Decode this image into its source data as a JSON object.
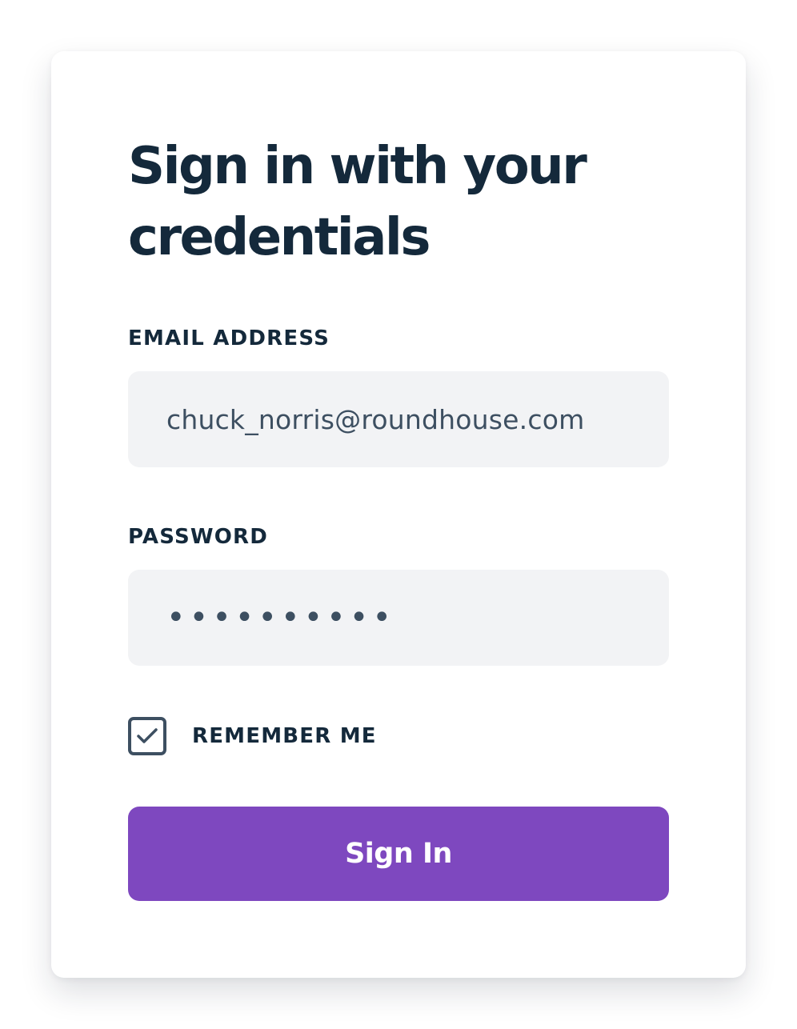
{
  "form": {
    "heading": "Sign in with your credentials",
    "email_label": "EMAIL ADDRESS",
    "email_value": "chuck_norris@roundhouse.com",
    "password_label": "PASSWORD",
    "password_value": "••••••••••",
    "remember_label": "REMEMBER ME",
    "remember_checked": true,
    "submit_label": "Sign In"
  },
  "icons": {
    "checkbox": "check-icon"
  },
  "colors": {
    "accent": "#7e48bf",
    "text_dark": "#14293b",
    "input_bg": "#f2f3f5",
    "input_text": "#3d4f61"
  }
}
